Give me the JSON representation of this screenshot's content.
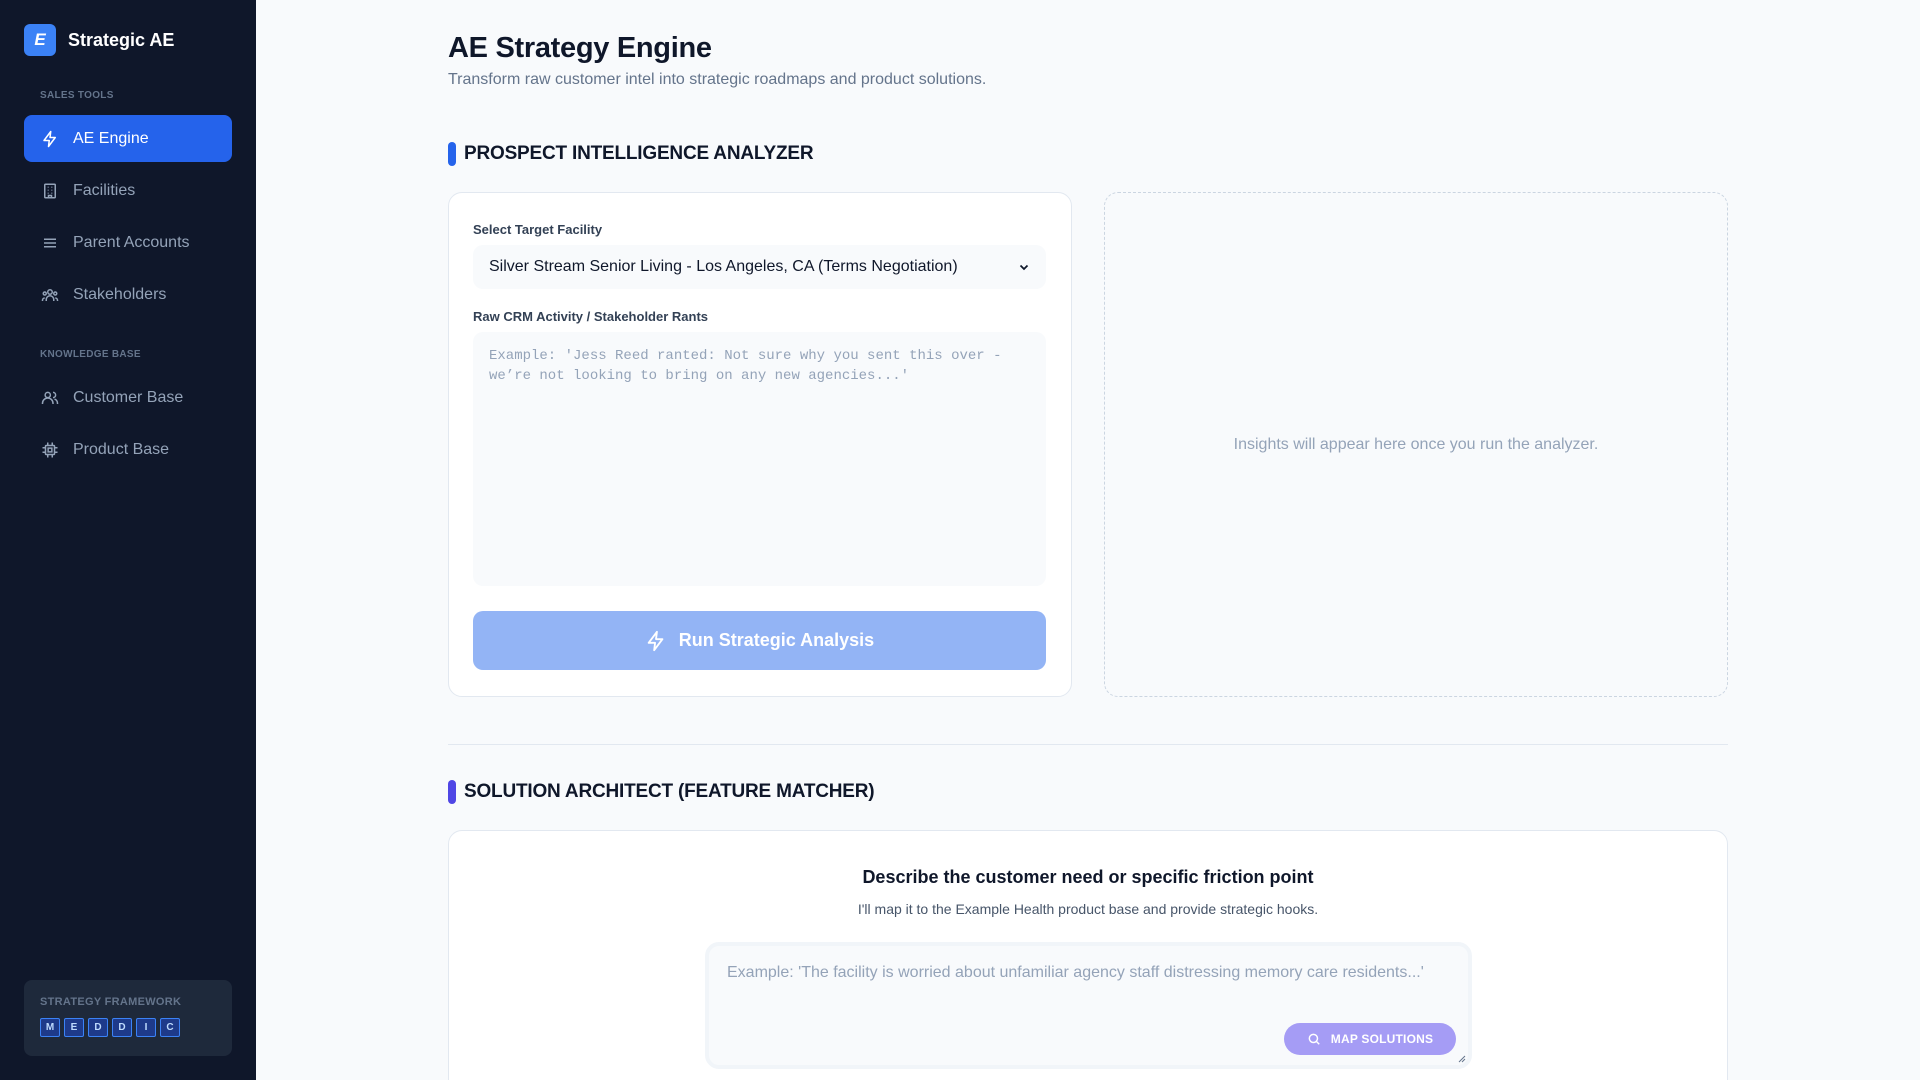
{
  "sidebar": {
    "brand_logo": "E",
    "brand_name": "Strategic AE",
    "section_sales": "SALES TOOLS",
    "section_knowledge": "KNOWLEDGE BASE",
    "items": [
      {
        "label": "AE Engine",
        "icon": "lightning-icon",
        "active": true
      },
      {
        "label": "Facilities",
        "icon": "building-icon",
        "active": false
      },
      {
        "label": "Parent Accounts",
        "icon": "menu-lines-icon",
        "active": false
      },
      {
        "label": "Stakeholders",
        "icon": "users-group-icon",
        "active": false
      },
      {
        "label": "Customer Base",
        "icon": "users-icon",
        "active": false
      },
      {
        "label": "Product Base",
        "icon": "chip-icon",
        "active": false
      }
    ],
    "framework": {
      "title": "STRATEGY FRAMEWORK",
      "letters": [
        "M",
        "E",
        "D",
        "D",
        "I",
        "C"
      ]
    }
  },
  "header": {
    "title": "AE Strategy Engine",
    "subtitle": "Transform raw customer intel into strategic roadmaps and product solutions."
  },
  "analyzer": {
    "section_title": "PROSPECT INTELLIGENCE ANALYZER",
    "accent_color": "#2563eb",
    "facility_label": "Select Target Facility",
    "facility_selected": "Silver Stream Senior Living - Los Angeles, CA (Terms Negotiation)",
    "crm_label": "Raw CRM Activity / Stakeholder Rants",
    "crm_placeholder": "Example: 'Jess Reed ranted: Not sure why you sent this over - we’re not looking to bring on any new agencies...'",
    "run_button": "Run Strategic Analysis",
    "insights_placeholder": "Insights will appear here once you run the analyzer."
  },
  "solution": {
    "section_title": "SOLUTION ARCHITECT (FEATURE MATCHER)",
    "accent_color": "#4f46e5",
    "heading": "Describe the customer need or specific friction point",
    "subheading": "I'll map it to the Example Health product base and provide strategic hooks.",
    "need_placeholder": "Example: 'The facility is worried about unfamiliar agency staff distressing memory care residents...'",
    "map_button": "MAP SOLUTIONS"
  }
}
